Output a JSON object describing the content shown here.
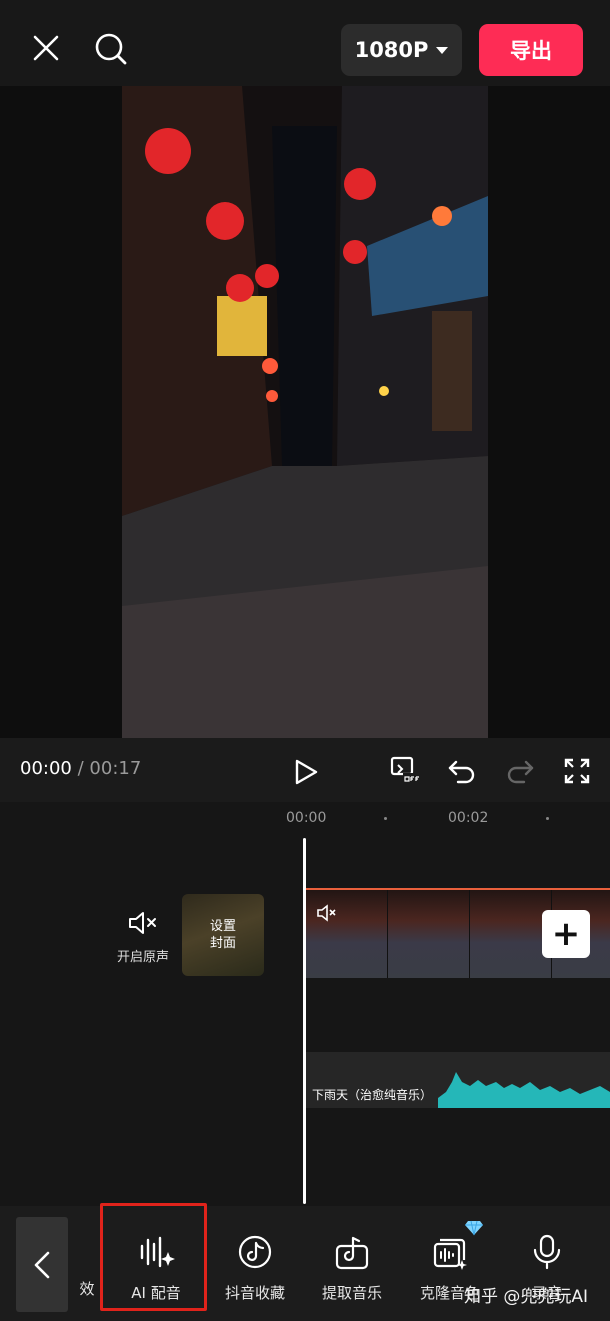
{
  "topbar": {
    "close_icon": "close-icon",
    "search_icon": "search-icon",
    "resolution": "1080P",
    "export_label": "导出",
    "export_color": "#fe2c55"
  },
  "controls": {
    "current_time": "00:00",
    "separator": "/",
    "total_time": "00:17"
  },
  "timeline": {
    "ruler": [
      "00:00",
      "00:02"
    ],
    "original_sound_label": "开启原声",
    "cover_label_line1": "设置",
    "cover_label_line2": "封面",
    "audio_track_label": "下雨天（治愈纯音乐）",
    "track_accent": "#e9603c",
    "waveform_color": "#25b7b8"
  },
  "bottom_tools": [
    {
      "label": "AI 配音",
      "icon": "ai-voice-icon"
    },
    {
      "label": "抖音收藏",
      "icon": "tiktok-note-icon"
    },
    {
      "label": "提取音乐",
      "icon": "extract-music-icon"
    },
    {
      "label": "克隆音色",
      "icon": "clone-voice-icon"
    },
    {
      "label": "录音",
      "icon": "microphone-icon"
    }
  ],
  "partial_tool_label": "效",
  "watermark": "知乎 @兜兜玩AI"
}
